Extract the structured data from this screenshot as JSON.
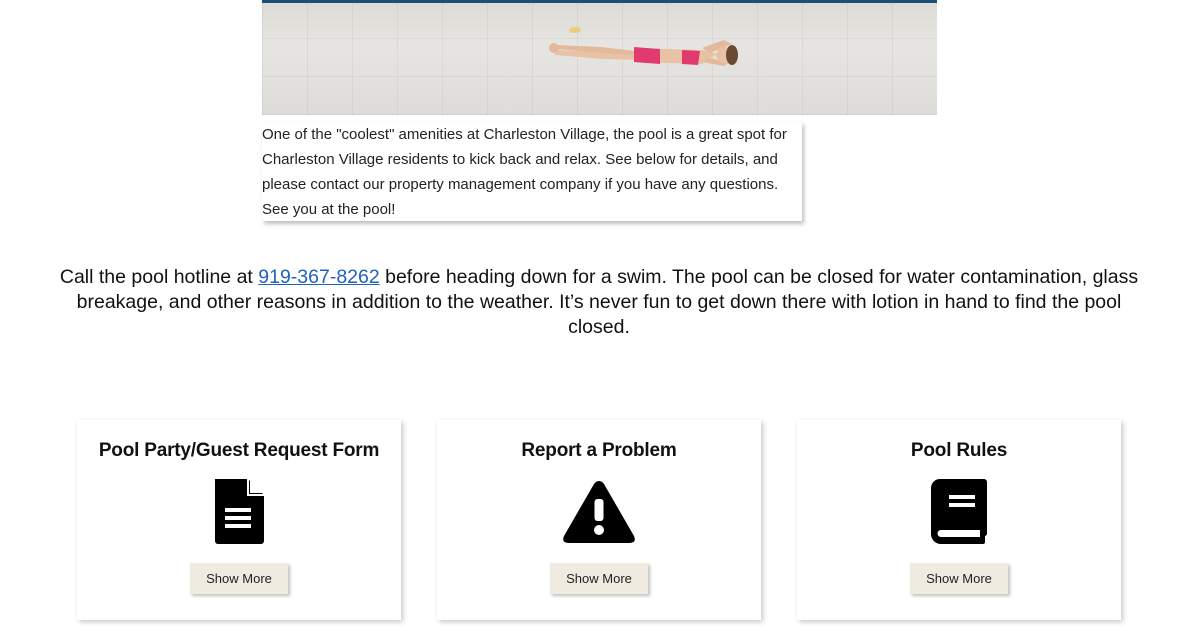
{
  "intro": {
    "text": "One of the \"coolest\" amenities at Charleston Village, the pool is a great spot for Charleston Village residents to kick back and relax. See below for details, and please contact our property management company if you have any questions. See you at the pool!"
  },
  "hotline": {
    "before": "Call the pool hotline at ",
    "phone": "919-367-8262",
    "after": " before heading down for a swim. The pool can be closed for water contamination, glass breakage, and other reasons in addition to the weather. It’s never fun to get down there with lotion in hand to find the pool closed."
  },
  "cards": [
    {
      "title": "Pool Party/Guest Request Form",
      "icon": "document-icon",
      "button": "Show More"
    },
    {
      "title": "Report a Problem",
      "icon": "warning-icon",
      "button": "Show More"
    },
    {
      "title": "Pool Rules",
      "icon": "book-icon",
      "button": "Show More"
    }
  ],
  "colors": {
    "link": "#1f63b8",
    "button_bg": "#efebe0",
    "pool_edge": "#1b4f7a"
  }
}
